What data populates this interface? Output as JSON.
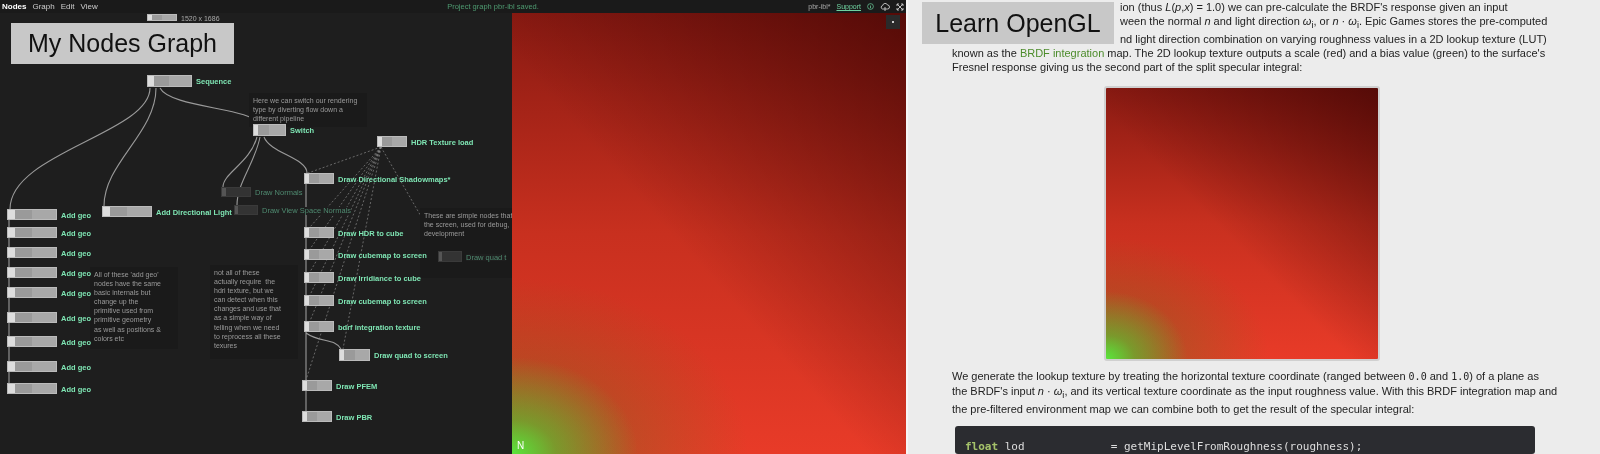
{
  "app": {
    "menu": [
      {
        "label": "Nodes",
        "selected": true
      },
      {
        "label": "Graph",
        "selected": false
      },
      {
        "label": "Edit",
        "selected": false
      },
      {
        "label": "View",
        "selected": false
      }
    ],
    "status": "Project graph pbr-ibl saved.",
    "project": "pbr-ibl*",
    "support_link": "Support"
  },
  "graph_title": "My Nodes Graph",
  "graph": {
    "nodes": [
      {
        "label": "1520 x 1686",
        "kind": "size"
      },
      {
        "label": "Sequence",
        "kind": "active"
      },
      {
        "label": "Switch",
        "kind": "active"
      },
      {
        "label": "HDR Texture load",
        "kind": "active"
      },
      {
        "label": "Draw Directional Shadowmaps*",
        "kind": "active"
      },
      {
        "label": "Draw  Normals",
        "kind": "disabled"
      },
      {
        "label": "Add Directional Light",
        "kind": "active"
      },
      {
        "label": "Draw View Space Normals",
        "kind": "disabled"
      },
      {
        "label": "Add geo",
        "kind": "active"
      },
      {
        "label": "Add geo",
        "kind": "active"
      },
      {
        "label": "Add geo",
        "kind": "active"
      },
      {
        "label": "Add geo",
        "kind": "active"
      },
      {
        "label": "Add geo",
        "kind": "active"
      },
      {
        "label": "Add geo",
        "kind": "active"
      },
      {
        "label": "Add geo",
        "kind": "active"
      },
      {
        "label": "Add geo",
        "kind": "active"
      },
      {
        "label": "Add geo",
        "kind": "active"
      },
      {
        "label": "Draw HDR to cube",
        "kind": "active"
      },
      {
        "label": "Draw cubemap to screen",
        "kind": "active"
      },
      {
        "label": "Draw Irridiance to cube",
        "kind": "active"
      },
      {
        "label": "Draw cubemap to screen",
        "kind": "active"
      },
      {
        "label": "bdrf integration texture",
        "kind": "active"
      },
      {
        "label": "Draw quad to screen",
        "kind": "active"
      },
      {
        "label": "Draw PFEM",
        "kind": "active"
      },
      {
        "label": "Draw  PBR",
        "kind": "active"
      },
      {
        "label": "Draw quad t",
        "kind": "disabled"
      }
    ],
    "comments": [
      "Here we can switch our rendering\ntype by diverting flow down a\ndifferent pipeline",
      "These are simple nodes that\nthe screen, used for debug,\ndevelopment",
      "All of these 'add geo'\nnodes have the same\nbasic internals but\nchange up the\nprimitive used from\nprimitive geometry\nas well as positions &\ncolors etc",
      "not all of these\nactually require  the\nhdri texture, but we\ncan detect when this\nchanges and use that\nas a simple way of\ntelling when we need\nto reprocess all these\ntexures"
    ]
  },
  "viewport": {
    "corner_label": "N"
  },
  "page_title": "Learn OpenGL",
  "article": {
    "fragments": [
      "ion (thus *L*(*p*,*x*) = 1.0) we can pre-calculate the BRDF's response given an input",
      "ween the normal *n* and light direction *ω*$_{i}$, or *n* · *ω*$_{i}$. Epic Games stores the pre-computed",
      "nd light direction combination on varying roughness values in a 2D lookup texture (LUT)"
    ],
    "lines_before_link": "known as the ",
    "link": "BRDF integration",
    "lines_after_link": " map. The 2D lookup texture outputs a scale (red) and a bias value (green) to the surface's\nFresnel response giving us the second part of the split specular integral:",
    "figure": {
      "kind": "picture"
    },
    "paragraph": [
      {
        "kind": "text",
        "text": "We generate the lookup texture by treating the horizontal texture coordinate (ranged between "
      },
      {
        "kind": "code",
        "text": "0.0"
      },
      {
        "kind": "text",
        "text": " and "
      },
      {
        "kind": "code",
        "text": "1.0"
      },
      {
        "kind": "text",
        "text": ") of a plane as\nthe BRDF's input *n* · *ω*$_{i}$, and its vertical texture coordinate as the input roughness value. With this BRDF integration map and\nthe pre-filtered environment map we can combine both to get the result of the specular integral:"
      }
    ],
    "code": [
      {
        "kind": "keyword",
        "text": "float"
      },
      {
        "kind": "plain",
        "text": " lod             = getMipLevelFromRoughness(roughness);"
      }
    ]
  }
}
